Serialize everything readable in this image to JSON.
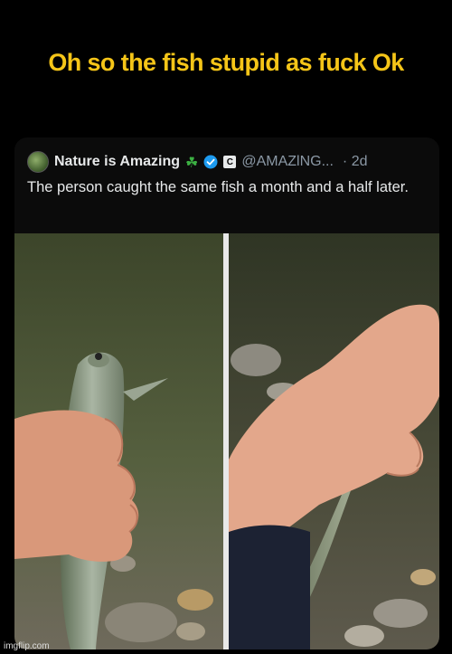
{
  "meme": {
    "caption": "Oh so the fish stupid as fuck Ok"
  },
  "tweet": {
    "display_name": "Nature is Amazing",
    "handle": "@AMAZlNG...",
    "time": "· 2d",
    "text": "The person caught the same fish a month and a half later.",
    "icons": [
      "shamrock-icon",
      "verified-badge-icon",
      "c-label-icon"
    ],
    "colors": {
      "clover": "#3cb043",
      "verified": "#1d9bf0",
      "caption": "#f5c518"
    }
  },
  "photos": [
    {
      "name": "fish-with-fresh-wound"
    },
    {
      "name": "fish-healed-scar"
    }
  ],
  "watermark": "imgflip.com"
}
